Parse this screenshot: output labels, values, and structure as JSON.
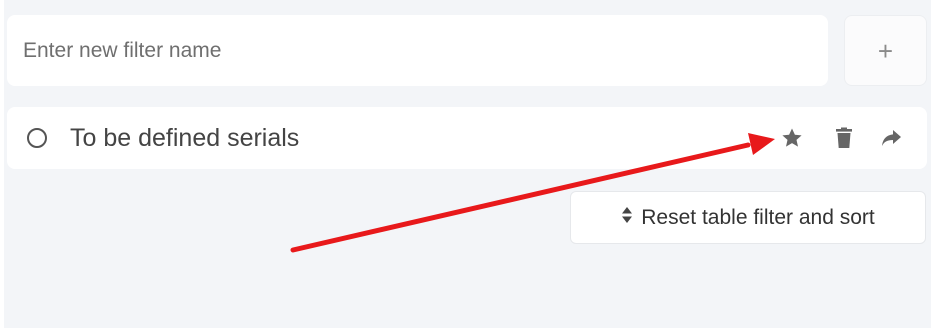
{
  "filter_input": {
    "placeholder": "Enter new filter name",
    "value": ""
  },
  "add_button": {
    "label": "+"
  },
  "saved_filters": [
    {
      "label": "To be defined serials",
      "selected": false
    }
  ],
  "row_actions": [
    "star-icon",
    "trash-icon",
    "share-icon"
  ],
  "reset_button": {
    "label": "Reset table filter and sort",
    "icon": "sort-icon"
  },
  "colors": {
    "background": "#f3f5f8",
    "annotation_arrow": "#e8191b",
    "icon": "#666666"
  }
}
